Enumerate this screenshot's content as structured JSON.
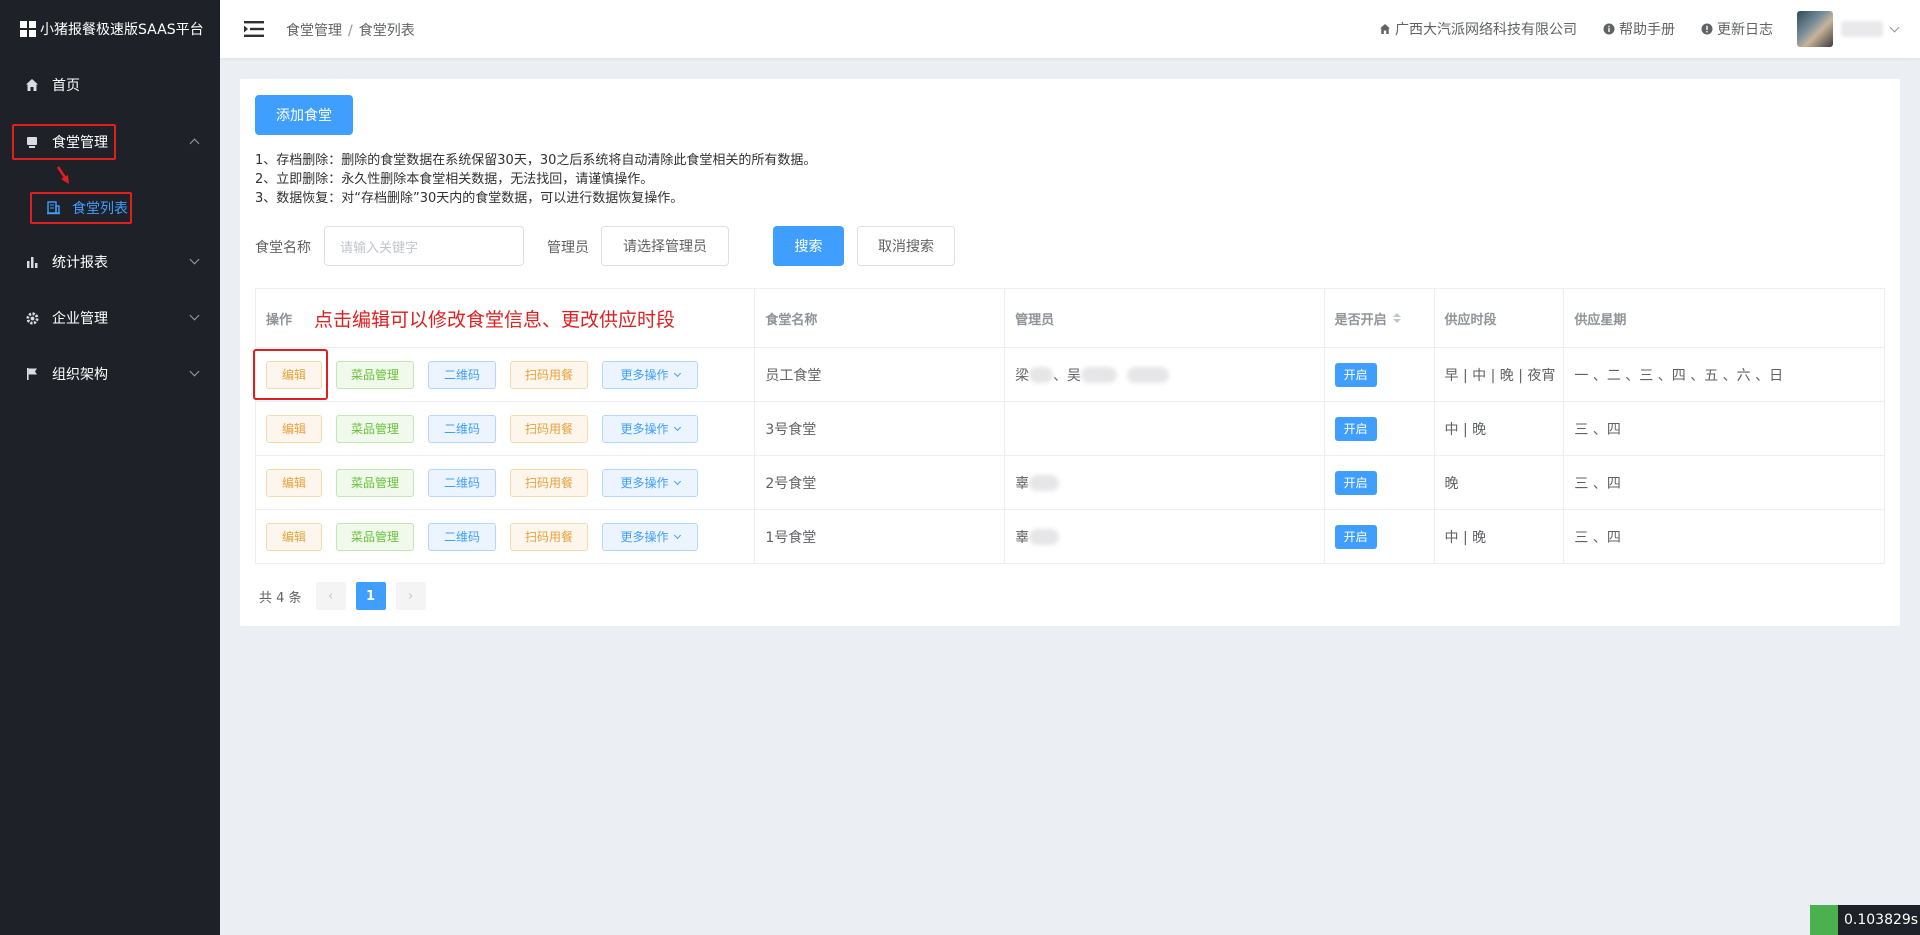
{
  "sidebar": {
    "brand": "小猪报餐极速版SAAS平台",
    "items": [
      {
        "label": "首页"
      },
      {
        "label": "食堂管理"
      },
      {
        "label": "食堂列表"
      },
      {
        "label": "统计报表"
      },
      {
        "label": "企业管理"
      },
      {
        "label": "组织架构"
      }
    ]
  },
  "header": {
    "breadcrumb": [
      "食堂管理",
      "食堂列表"
    ],
    "separator": "/",
    "company": "广西大汽派网络科技有限公司",
    "help": "帮助手册",
    "changelog": "更新日志"
  },
  "main": {
    "add_button": "添加食堂",
    "notes": [
      "1、存档删除：删除的食堂数据在系统保留30天，30之后系统将自动清除此食堂相关的所有数据。",
      "2、立即删除：永久性删除本食堂相关数据，无法找回，请谨慎操作。",
      "3、数据恢复：对“存档删除”30天内的食堂数据，可以进行数据恢复操作。"
    ],
    "filter": {
      "name_label": "食堂名称",
      "name_placeholder": "请输入关键字",
      "admin_label": "管理员",
      "admin_select": "请选择管理员",
      "search": "搜索",
      "cancel": "取消搜索"
    },
    "table": {
      "headers": [
        "操作",
        "食堂名称",
        "管理员",
        "是否开启",
        "供应时段",
        "供应星期"
      ],
      "annotation": "点击编辑可以修改食堂信息、更改供应时段",
      "actions": {
        "edit": "编辑",
        "dishes": "菜品管理",
        "qrcode": "二维码",
        "scan": "扫码用餐",
        "more": "更多操作"
      },
      "rows": [
        {
          "name": "员工食堂",
          "admin": "梁",
          "admin2": "、吴",
          "status": "开启",
          "periods": "早 | 中 | 晚 | 夜宵",
          "weekdays": "一 、二 、三 、四 、五 、六 、日"
        },
        {
          "name": "3号食堂",
          "admin": "",
          "admin2": "",
          "status": "开启",
          "periods": "中 | 晚",
          "weekdays": "三 、四"
        },
        {
          "name": "2号食堂",
          "admin": "辜",
          "admin2": "",
          "status": "开启",
          "periods": "晚",
          "weekdays": "三 、四"
        },
        {
          "name": "1号食堂",
          "admin": "辜",
          "admin2": "",
          "status": "开启",
          "periods": "中 | 晚",
          "weekdays": "三 、四"
        }
      ]
    },
    "pagination": {
      "total": "共 4 条",
      "current": "1",
      "prev": "‹",
      "next": "›"
    }
  },
  "timer": "0.103829s",
  "colors": {
    "primary": "#409eff",
    "sidebar": "#1f2129",
    "annotation": "#e02020"
  }
}
